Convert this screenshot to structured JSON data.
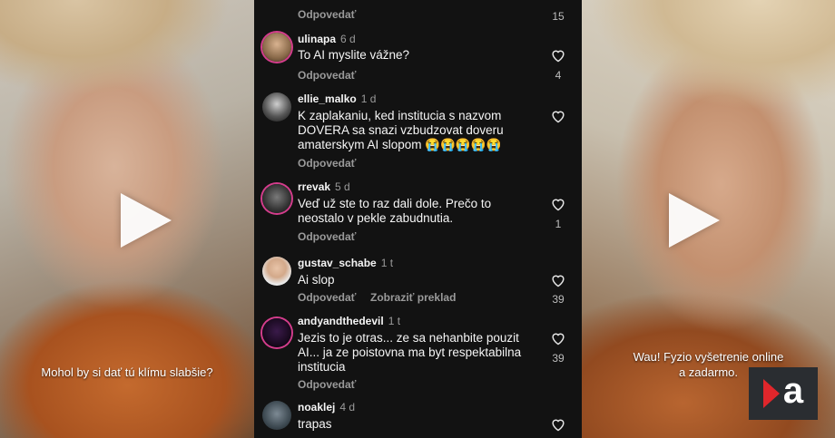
{
  "left_video": {
    "subtitle": "Mohol by si dať tú klímu slabšie?"
  },
  "right_video": {
    "subtitle_line1": "Wau! Fyzio vyšetrenie online",
    "subtitle_line2": "a zadarmo."
  },
  "logo": {
    "letter": "a"
  },
  "top_partial": {
    "reply_label": "Odpovedať",
    "likes": "15"
  },
  "comments": [
    {
      "username": "ulinapa",
      "age": "6 d",
      "text": "To AI myslite vážne?",
      "reply_label": "Odpovedať",
      "likes": "4"
    },
    {
      "username": "ellie_malko",
      "age": "1 d",
      "text": "K zaplakaniu, ked institucia s nazvom DOVERA sa snazi vzbudzovat doveru amaterskym AI slopom 😭😭😭😭😭",
      "reply_label": "Odpovedať",
      "likes": ""
    },
    {
      "username": "rrevak",
      "age": "5 d",
      "text": "Veď už ste to raz dali dole. Prečo to neostalo v pekle zabudnutia.",
      "reply_label": "Odpovedať",
      "likes": "1"
    },
    {
      "username": "gustav_schabe",
      "age": "1 t",
      "text": "Ai slop",
      "reply_label": "Odpovedať",
      "translate_label": "Zobraziť preklad",
      "likes": "39"
    },
    {
      "username": "andyandthedevil",
      "age": "1 t",
      "text": "Jezis to je otras... ze sa nehanbite pouzit AI... ja ze poistovna ma byt respektabilna institucia",
      "reply_label": "Odpovedať",
      "likes": "39"
    },
    {
      "username": "noaklej",
      "age": "4 d",
      "text": "trapas",
      "likes": ""
    }
  ],
  "colors": {
    "background": "#121212",
    "story_ring": "#d43d8c",
    "logo_red": "#e0262b"
  }
}
